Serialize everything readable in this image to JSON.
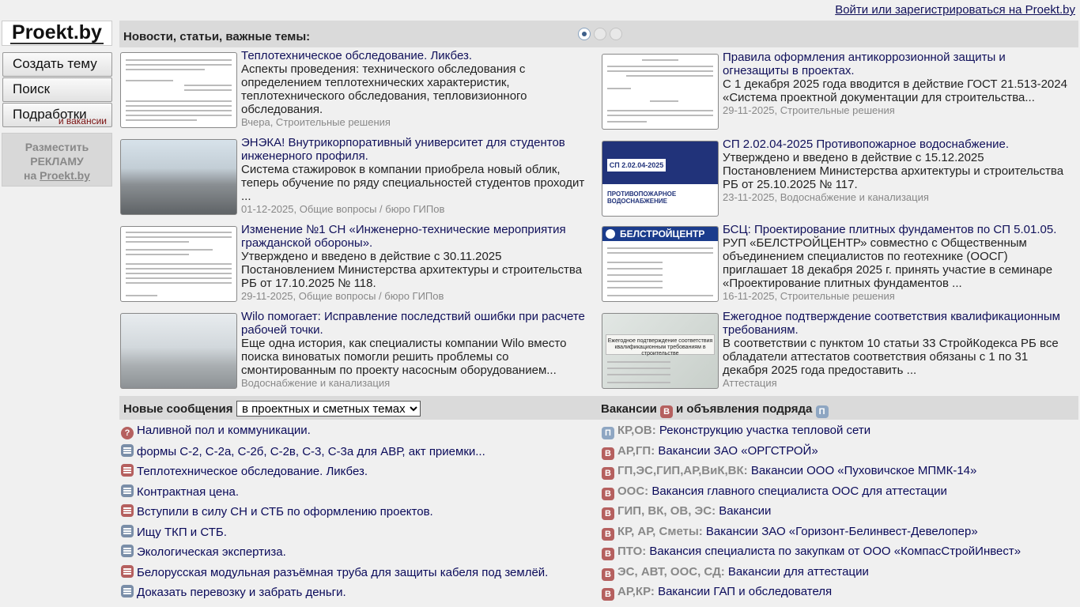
{
  "header": {
    "login_link": "Войти или зарегистрироваться на Proekt.by"
  },
  "sidebar": {
    "logo": "Proekt.by",
    "buttons": {
      "create": "Создать тему",
      "search": "Поиск",
      "jobs": "Подработки",
      "jobs_sub": "и вакансии"
    },
    "ad": {
      "line1": "Разместить",
      "line2": "РЕКЛАМУ",
      "line3_prefix": "на",
      "line3_site": "Proekt.by"
    }
  },
  "news": {
    "title": "Новости, статьи, важные темы:",
    "items": [
      {
        "title": "Теплотехническое обследование. Ликбез.",
        "desc": "Аспекты проведения: технического обследования с определением теплотехнических характеристик, теплотехнического обследования, тепловизионного обследования.",
        "meta": "Вчера, Строительные решения"
      },
      {
        "title": "Правила оформления антикоррозионной защиты и огнезащиты в проектах.",
        "desc": "С 1 декабря 2025 года вводится в действие ГОСТ 21.513-2024 «Система проектной документации для строительства...",
        "meta": "29-11-2025, Строительные решения"
      },
      {
        "title": "ЭНЭКА! Внутрикорпоративный университет для студентов инженерного профиля.",
        "desc": "Система стажировок в компании приобрела новый облик, теперь обучение по ряду специальностей студентов проходит ...",
        "meta": "01-12-2025, Общие вопросы / бюро ГИПов"
      },
      {
        "title": "СП 2.02.04-2025 Противопожарное водоснабжение.",
        "desc": "Утверждено и введено в действие с 15.12.2025 Постановлением Министерства архитектуры и строительства РБ от 25.10.2025 № 117.",
        "meta": "23-11-2025, Водоснабжение и канализация"
      },
      {
        "title": "Изменение №1 СН «Инженерно-технические мероприятия гражданской обороны».",
        "desc": "Утверждено и введено в действие с 30.11.2025 Постановлением Министерства архитектуры и строительства РБ от 17.10.2025 № 118.",
        "meta": "29-11-2025, Общие вопросы / бюро ГИПов"
      },
      {
        "title": "БСЦ: Проектирование плитных фундаментов по СП 5.01.05.",
        "desc": "РУП «БЕЛСТРОЙЦЕНТР» совместно с Общественным объединением специалистов по геотехнике (ООСГ) приглашает 18 декабря 2025 г. принять участие в семинаре «Проектирование плитных фундаментов ...",
        "meta": "16-11-2025, Строительные решения"
      },
      {
        "title": "Wilo помогает: Исправление последствий ошибки при расчете рабочей точки.",
        "desc": "Еще одна история, как специалисты компании Wilo вместо поиска виноватых помогли решить проблемы со смонтированным по проекту насосным оборудованием...",
        "meta": "Водоснабжение и канализация"
      },
      {
        "title": "Ежегодное подтверждение соответствия квалификационным требованиям.",
        "desc": "В соответствии с пунктом 10 статьи 33 СтройКодекса РБ все обладатели аттестатов соответствия обязаны с 1 по 31 декабря 2025 года предоставить ...",
        "meta": "Аттестация"
      }
    ],
    "thumbs": {
      "cover_label": "СП 2.02.04-2025",
      "cover_bottom": "ПРОТИВОПОЖАРНОЕ ВОДОСНАБЖЕНИЕ",
      "bsc_label": "БЕЛСТРОЙЦЕНТР",
      "cert_title": "Ежегодное подтверждение соответствия квалификационным требованиям в строительстве"
    }
  },
  "messages": {
    "title": "Новые сообщения",
    "select_value": "в проектных и сметных темах",
    "items": [
      {
        "type": "q",
        "text": "Наливной пол и коммуникации."
      },
      {
        "type": "list",
        "text": "формы С-2, С-2а, С-2б, С-2в, С-3, С-3а для АВР, акт приемки..."
      },
      {
        "type": "red",
        "text": "Теплотехническое обследование. Ликбез."
      },
      {
        "type": "list",
        "text": "Контрактная цена."
      },
      {
        "type": "red",
        "text": "Вступили в силу СН и СТБ по оформлению проектов."
      },
      {
        "type": "list",
        "text": "Ищу ТКП и СТБ."
      },
      {
        "type": "list",
        "text": "Экологическая экспертиза."
      },
      {
        "type": "red",
        "text": "Белорусская модульная разъёмная труба для защиты кабеля под землёй."
      },
      {
        "type": "list",
        "text": "Доказать перевозку и забрать деньги."
      }
    ]
  },
  "vacancies": {
    "title_part1": "Вакансии",
    "title_part2": "и объявления подряда",
    "badge_v": "В",
    "badge_p": "П",
    "items": [
      {
        "badge": "П",
        "type": "p",
        "prefix": "КР,ОВ:",
        "text": "Реконструкцию участка тепловой сети"
      },
      {
        "badge": "В",
        "type": "red",
        "prefix": "АР,ГП:",
        "text": "Вакансии ЗАО «ОРГСТРОЙ»"
      },
      {
        "badge": "В",
        "type": "red",
        "prefix": "ГП,ЭС,ГИП,АР,ВиК,ВК:",
        "text": "Вакансии ООО «Пуховичское МПМК-14»"
      },
      {
        "badge": "В",
        "type": "red",
        "prefix": "ООС:",
        "text": "Вакансия главного специалиста ООС для аттестации"
      },
      {
        "badge": "В",
        "type": "red",
        "prefix": "ГИП, ВК, ОВ, ЭС:",
        "text": "Вакансии"
      },
      {
        "badge": "В",
        "type": "red",
        "prefix": "КР, АР, Сметы:",
        "text": "Вакансии ЗАО «Горизонт-Белинвест-Девелопер»"
      },
      {
        "badge": "В",
        "type": "red",
        "prefix": "ПТО:",
        "text": "Вакансия специалиста по закупкам от ООО «КомпасСтройИнвест»"
      },
      {
        "badge": "В",
        "type": "red",
        "prefix": "ЭС, АВТ, ООС, СД:",
        "text": "Вакансии для аттестации"
      },
      {
        "badge": "В",
        "type": "red",
        "prefix": "АР,КР:",
        "text": "Вакансии ГАП и обследователя"
      }
    ]
  }
}
